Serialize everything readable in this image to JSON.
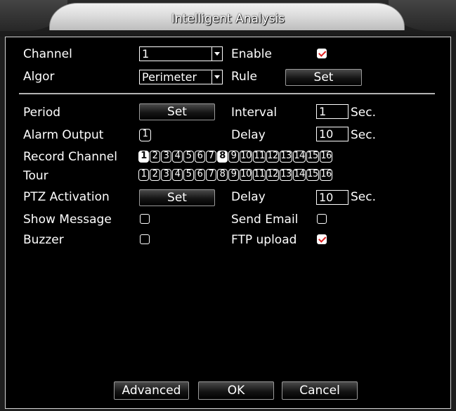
{
  "window": {
    "title": "Intelligent Analysis"
  },
  "row_channel": {
    "label": "Channel",
    "value": "1",
    "enable_label": "Enable",
    "enable_checked": true
  },
  "row_algor": {
    "label": "Algor",
    "value": "Perimeter",
    "rule_label": "Rule",
    "rule_button": "Set"
  },
  "row_period": {
    "label": "Period",
    "button": "Set",
    "interval_label": "Interval",
    "interval_value": "1",
    "interval_unit": "Sec."
  },
  "row_alarm": {
    "label": "Alarm Output",
    "output_value": "1",
    "delay_label": "Delay",
    "delay_value": "10",
    "delay_unit": "Sec."
  },
  "row_record": {
    "label": "Record Channel",
    "channels": [
      "1",
      "2",
      "3",
      "4",
      "5",
      "6",
      "7",
      "8",
      "9",
      "10",
      "11",
      "12",
      "13",
      "14",
      "15",
      "16"
    ],
    "selected": [
      "1",
      "8"
    ]
  },
  "row_tour": {
    "label": "Tour",
    "channels": [
      "1",
      "2",
      "3",
      "4",
      "5",
      "6",
      "7",
      "8",
      "9",
      "10",
      "11",
      "12",
      "13",
      "14",
      "15",
      "16"
    ],
    "selected": []
  },
  "row_ptz": {
    "label": "PTZ Activation",
    "button": "Set",
    "delay_label": "Delay",
    "delay_value": "10",
    "delay_unit": "Sec."
  },
  "row_message": {
    "label": "Show Message",
    "checked": false,
    "email_label": "Send Email",
    "email_checked": false
  },
  "row_buzzer": {
    "label": "Buzzer",
    "checked": false,
    "ftp_label": "FTP upload",
    "ftp_checked": true
  },
  "footer": {
    "advanced": "Advanced",
    "ok": "OK",
    "cancel": "Cancel"
  }
}
